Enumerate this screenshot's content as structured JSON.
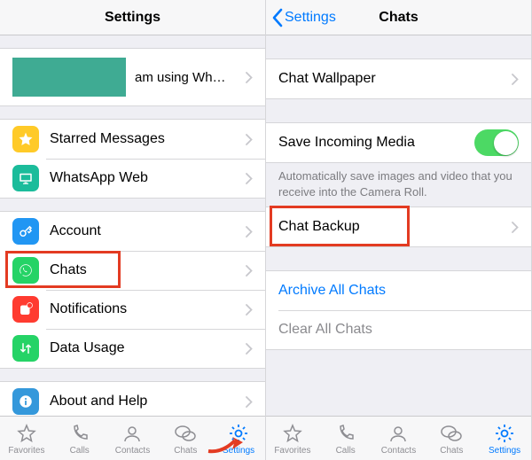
{
  "colors": {
    "accent": "#007aff",
    "toggle_on": "#4cd964",
    "highlight": "#e33b22",
    "icon_yellow": "#ffca28",
    "icon_teal": "#1bbc9b",
    "icon_blue": "#2196f3",
    "icon_green": "#25d366",
    "icon_red": "#ff3b30",
    "icon_blue2": "#3498db"
  },
  "left": {
    "navbar": {
      "title": "Settings"
    },
    "profile": {
      "status": "am using Wh…"
    },
    "group1": [
      {
        "key": "starred",
        "label": "Starred Messages",
        "icon": "star-icon",
        "icon_bg": "#ffca28"
      },
      {
        "key": "web",
        "label": "WhatsApp Web",
        "icon": "monitor-icon",
        "icon_bg": "#1bbc9b"
      }
    ],
    "group2": [
      {
        "key": "account",
        "label": "Account",
        "icon": "key-icon",
        "icon_bg": "#2196f3"
      },
      {
        "key": "chats",
        "label": "Chats",
        "icon": "whatsapp-icon",
        "icon_bg": "#25d366",
        "highlighted": true
      },
      {
        "key": "notifications",
        "label": "Notifications",
        "icon": "app-badge-icon",
        "icon_bg": "#ff3b30"
      },
      {
        "key": "data",
        "label": "Data Usage",
        "icon": "data-arrows-icon",
        "icon_bg": "#25d366"
      }
    ],
    "group3": [
      {
        "key": "about",
        "label": "About and Help",
        "icon": "info-icon",
        "icon_bg": "#3498db"
      }
    ],
    "tabs": [
      {
        "key": "favorites",
        "label": "Favorites",
        "icon": "star-outline-icon"
      },
      {
        "key": "calls",
        "label": "Calls",
        "icon": "phone-icon"
      },
      {
        "key": "contacts",
        "label": "Contacts",
        "icon": "contact-icon"
      },
      {
        "key": "chats",
        "label": "Chats",
        "icon": "chat-bubbles-icon"
      },
      {
        "key": "settings",
        "label": "Settings",
        "icon": "gear-icon",
        "active": true
      }
    ]
  },
  "right": {
    "navbar": {
      "back": "Settings",
      "title": "Chats"
    },
    "group1": [
      {
        "key": "wallpaper",
        "label": "Chat Wallpaper"
      }
    ],
    "group2": {
      "row": {
        "key": "save_media",
        "label": "Save Incoming Media",
        "toggle": true
      },
      "footer": "Automatically save images and video that you receive into the Camera Roll."
    },
    "group3": [
      {
        "key": "backup",
        "label": "Chat Backup",
        "highlighted": true
      }
    ],
    "group4": [
      {
        "key": "archive",
        "label": "Archive All Chats",
        "style": "link"
      },
      {
        "key": "clear",
        "label": "Clear All Chats",
        "style": "muted"
      }
    ],
    "tabs_active": "settings"
  }
}
